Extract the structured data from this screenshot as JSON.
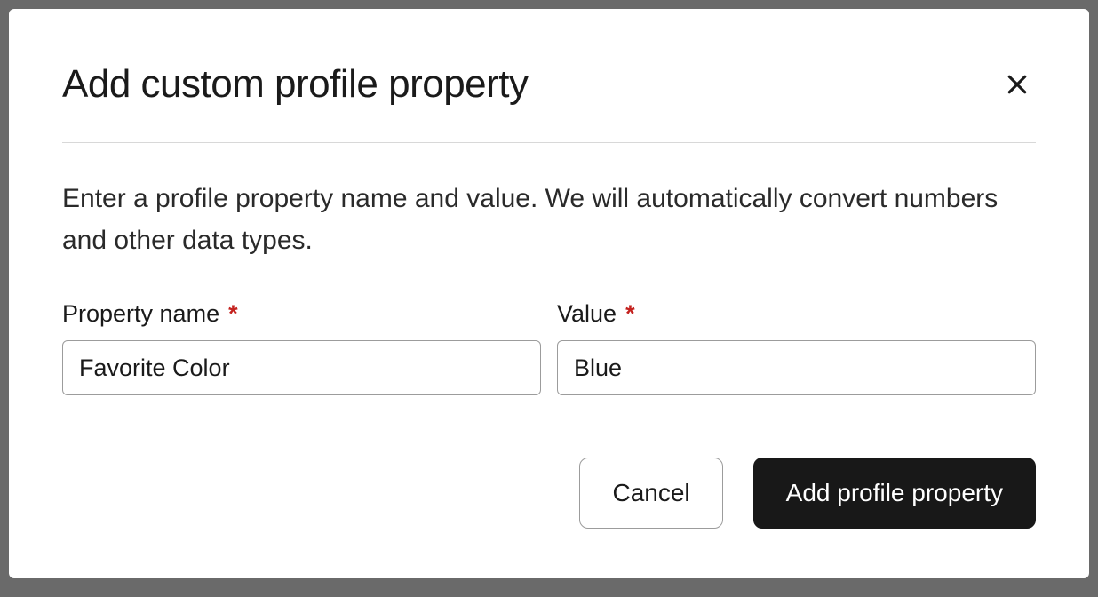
{
  "modal": {
    "title": "Add custom profile property",
    "description": "Enter a profile property name and value. We will automatically convert numbers and other data types.",
    "fields": {
      "property_name": {
        "label": "Property name",
        "value": "Favorite Color"
      },
      "value": {
        "label": "Value",
        "value": "Blue"
      }
    },
    "buttons": {
      "cancel": "Cancel",
      "submit": "Add profile property"
    }
  }
}
